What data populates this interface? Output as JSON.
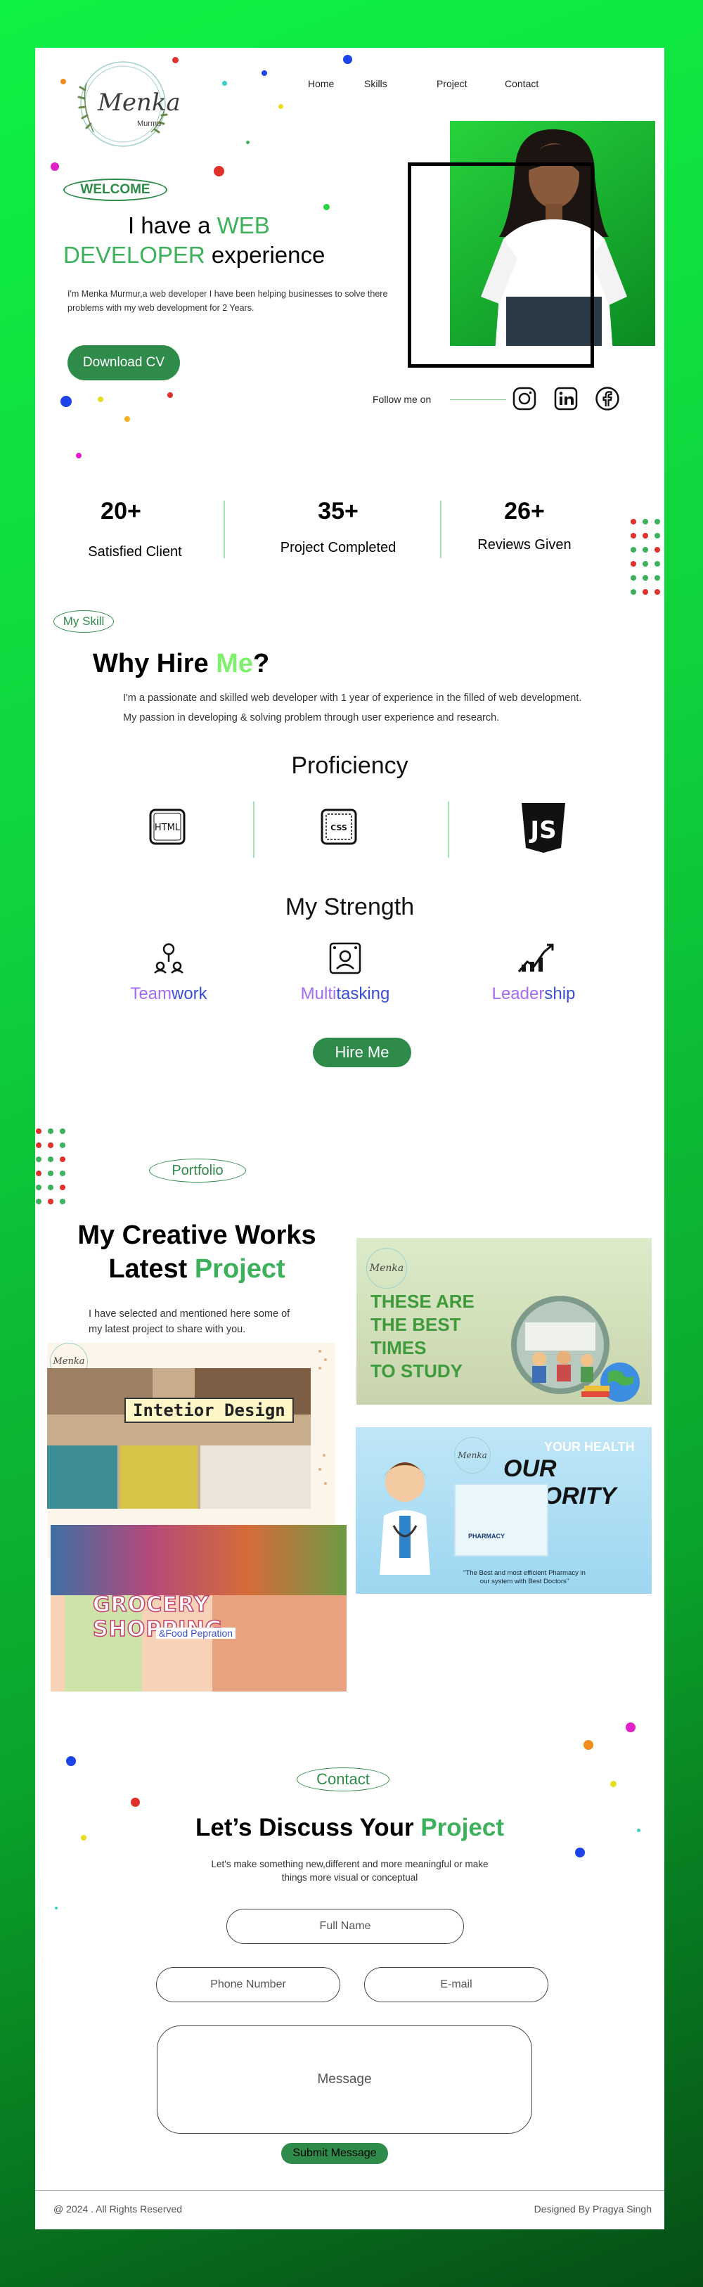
{
  "brand": {
    "logo_name": "Menka",
    "logo_sub": "Murmu"
  },
  "nav": {
    "home": "Home",
    "skills": "Skills",
    "project": "Project",
    "contact": "Contact"
  },
  "hero": {
    "badge": "WELCOME",
    "title_a": "I have a ",
    "title_b": "WEB",
    "title_c": "DEVELOPER",
    "title_d": " experience",
    "desc_1": "I'm Menka Murmur,a web developer I have been helping businesses to solve there",
    "desc_2": "problems with my web development for 2 Years.",
    "cta": "Download CV",
    "follow": "Follow me on"
  },
  "stats": [
    {
      "num": "20+",
      "label": "Satisfied Client"
    },
    {
      "num": "35+",
      "label": "Project Completed"
    },
    {
      "num": "26+",
      "label": "Reviews Given"
    }
  ],
  "skills": {
    "badge": "My Skill",
    "title_a": "Why Hire ",
    "title_b": "Me",
    "title_c": "?",
    "desc_1": "I'm a passionate and skilled web developer with 1 year of experience in the filled of web development.",
    "desc_2": "My passion in developing & solving problem through user experience and research.",
    "proficiency": "Proficiency",
    "html_icon": "HTML",
    "css_icon": "CSS",
    "js_icon": "JS",
    "strength": "My Strength",
    "strengths": [
      {
        "a": "Team",
        "b": "work"
      },
      {
        "a": "Multi",
        "b": "tasking"
      },
      {
        "a": "Leader",
        "b": "ship"
      }
    ],
    "cta": "Hire Me"
  },
  "portfolio": {
    "badge": "Portfolio",
    "title_1": "My Creative Works",
    "title_2a": "Latest ",
    "title_2b": "Project",
    "desc_1": "I have selected and mentioned here some of",
    "desc_2": "my latest project to share with you.",
    "card_study": [
      "THESE ARE",
      "THE BEST",
      "TIMES",
      "TO STUDY"
    ],
    "card_interior": "Intetior Design",
    "card_health_1": "YOUR HEALTH",
    "card_health_2": "OUR PRIORITY",
    "card_health_3": "\"The Best and most efficient Pharmacy in",
    "card_health_4": "our system with Best Doctors\"",
    "card_pharmacy": "PHARMACY",
    "card_grocery_1": "GROCERY SHOPPING",
    "card_grocery_2": "&Food Pepration",
    "card_logo": "Menka"
  },
  "contact": {
    "badge": "Contact",
    "title_a": "Let’s Discuss Your ",
    "title_b": "Project",
    "desc_1": "Let's make something new,different and more meaningful or make",
    "desc_2": "things more visual or conceptual",
    "full_name": "Full Name",
    "phone": "Phone Number",
    "email": "E-mail",
    "message": "Message",
    "submit": "Submit Message"
  },
  "footer": {
    "copyright": "@ 2024 . All Rights Reserved",
    "credit": "Designed By Pragya Singh"
  },
  "colors": {
    "accent": "#3cb05a",
    "button": "#2e8b4a",
    "strength_a": "#a56bf0",
    "strength_b": "#3a4ed1"
  }
}
